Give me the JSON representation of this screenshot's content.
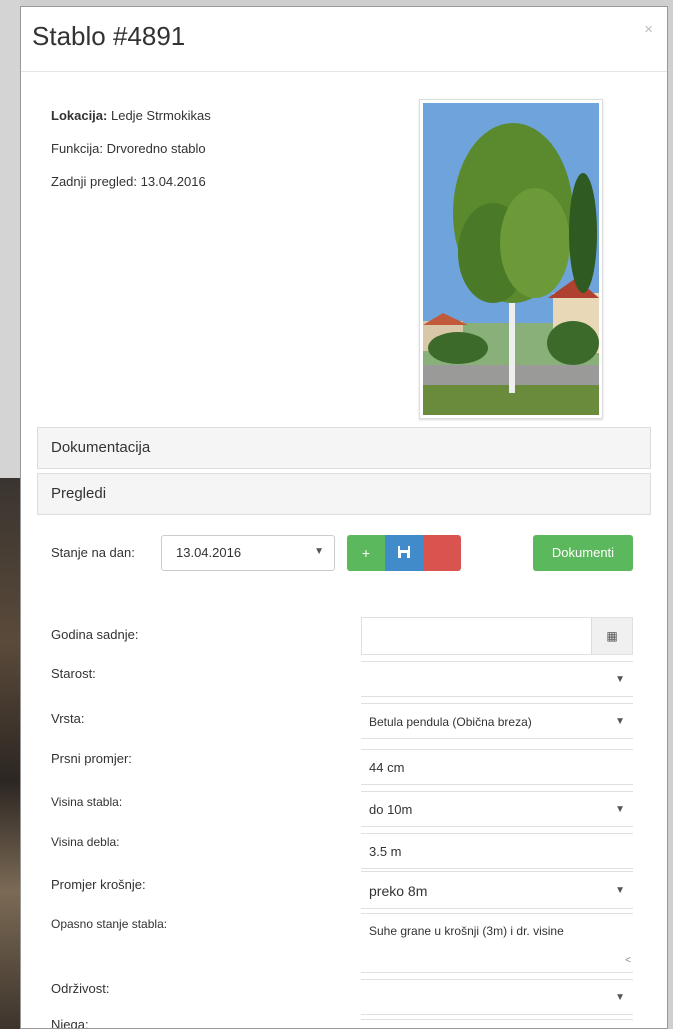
{
  "modal": {
    "title": "Stablo #4891",
    "close": "×"
  },
  "info": {
    "location_label": "Lokacija:",
    "location_value": "Ledje Strmokikas",
    "function_label": "Funkcija:",
    "function_value": "Drvoredno stablo",
    "last_review_label": "Zadnji pregled:",
    "last_review_value": "13.04.2016"
  },
  "panels": [
    "Dokumentacija",
    "Pregledi"
  ],
  "state": {
    "label": "Stanje na dan:",
    "selected_date": "13.04.2016",
    "add_icon": "plus-icon",
    "save_icon": "floppy-icon",
    "docs_button": "Dokumenti"
  },
  "form": [
    {
      "label": "Godina sadnje:",
      "value": "",
      "control": "date"
    },
    {
      "label": "Starost:",
      "value": "",
      "control": "select"
    },
    {
      "label": "Vrsta:",
      "value": "Betula pendula (Obična breza)",
      "control": "select"
    },
    {
      "label": "Prsni promjer:",
      "value": "44 cm",
      "control": "text"
    },
    {
      "label": "Visina stabla:",
      "value": "do 10m",
      "control": "select"
    },
    {
      "label": "Visina debla:",
      "value": "3.5 m",
      "control": "text"
    },
    {
      "label": "Promjer krošnje:",
      "value": "preko 8m",
      "control": "select"
    },
    {
      "label": "Opasno stanje stabla:",
      "value": "Suhe grane u krošnji (3m) i dr. visine",
      "control": "textarea"
    },
    {
      "label": "Održivost:",
      "value": "",
      "control": "select"
    },
    {
      "label": "Njega:",
      "value": "",
      "control": "select"
    }
  ]
}
